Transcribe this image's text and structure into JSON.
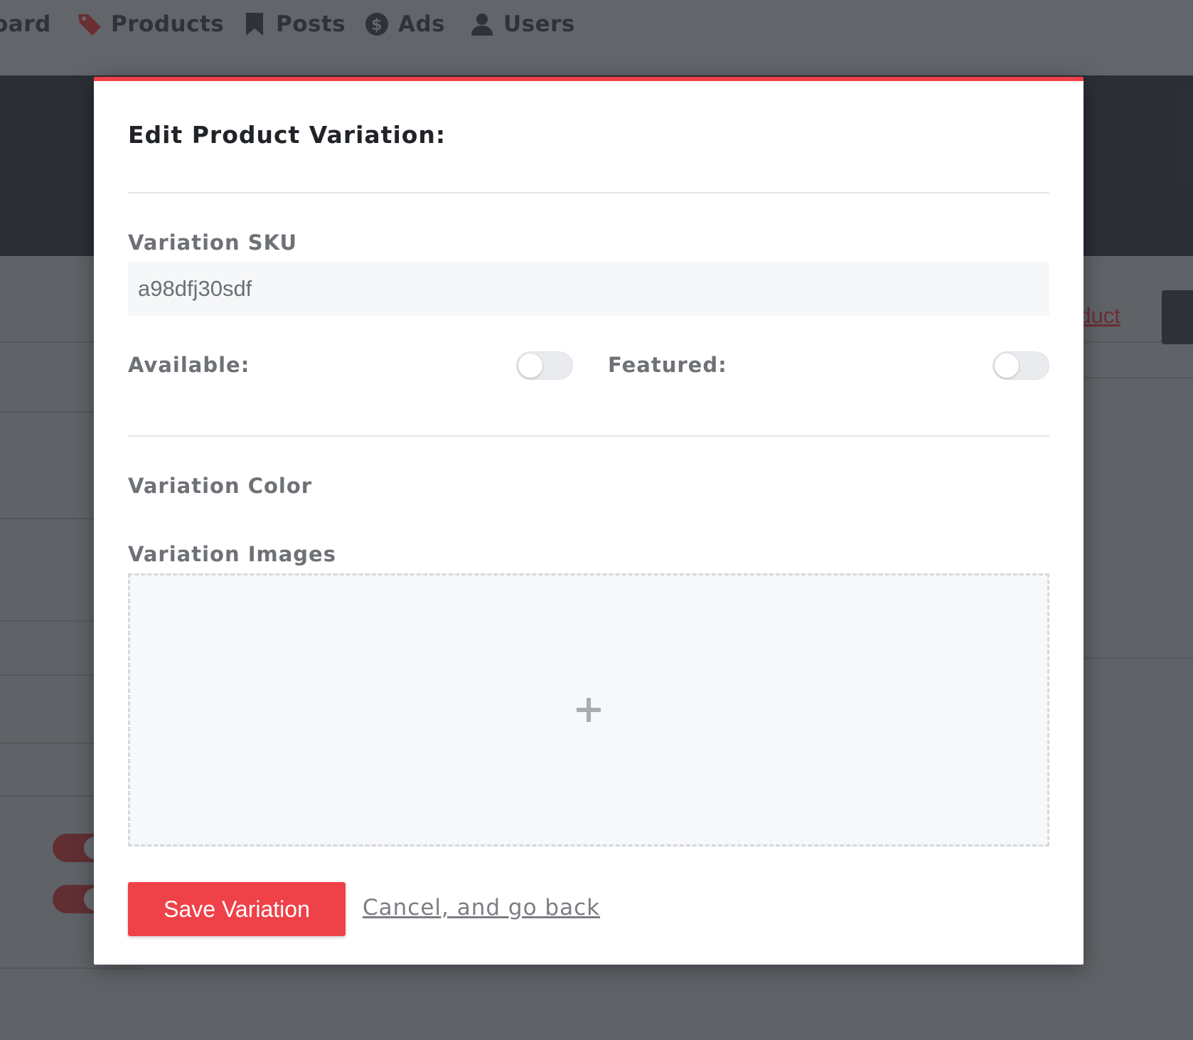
{
  "nav": {
    "items": [
      {
        "label": "oard",
        "icon": "dashboard-icon"
      },
      {
        "label": "Products",
        "icon": "tag-icon"
      },
      {
        "label": "Posts",
        "icon": "bookmark-icon"
      },
      {
        "label": "Ads",
        "icon": "dollar-coin-icon"
      },
      {
        "label": "Users",
        "icon": "user-icon"
      }
    ]
  },
  "background": {
    "link_text": "oduct"
  },
  "modal": {
    "title": "Edit Product Variation:",
    "sku_label": "Variation SKU",
    "sku_value": "a98dfj30sdf",
    "available_label": "Available:",
    "available_on": false,
    "featured_label": "Featured:",
    "featured_on": false,
    "color_label": "Variation Color",
    "images_label": "Variation Images",
    "add_image_icon": "plus-icon",
    "save_label": "Save Variation",
    "cancel_label": "Cancel, and go back"
  },
  "colors": {
    "accent": "#ef4148",
    "overlay": "#6b6e73",
    "hero": "#262930"
  }
}
